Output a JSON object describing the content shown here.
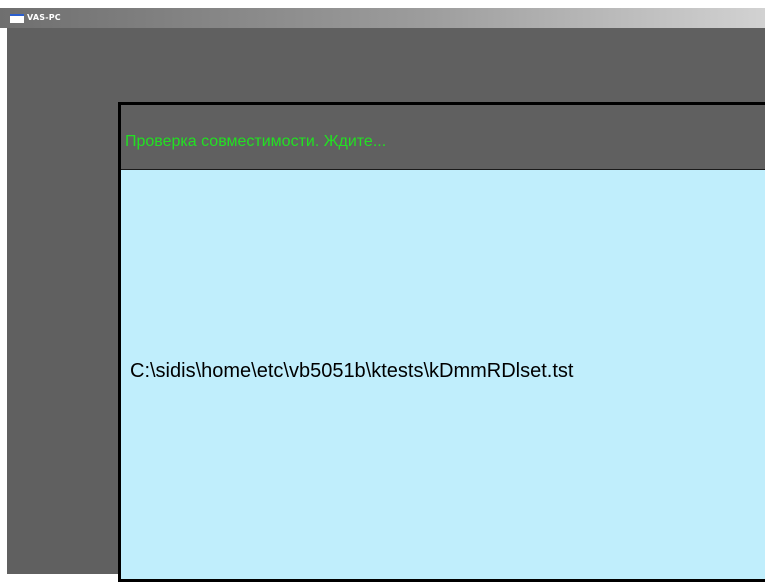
{
  "window": {
    "title": "VAS-PC",
    "icon": "window-icon"
  },
  "dialog": {
    "status_text": "Проверка совместимости. Ждите...",
    "current_file": "C:\\sidis\\home\\etc\\vb5051b\\ktests\\kDmmRDlset.tst"
  },
  "colors": {
    "desktop_bg": "#606060",
    "status_text": "#22e022",
    "body_bg": "#c0eefc"
  }
}
